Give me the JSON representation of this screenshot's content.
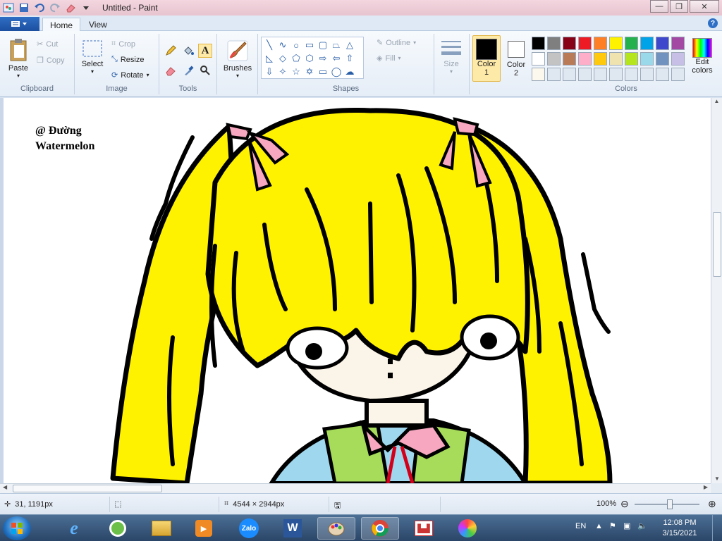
{
  "window": {
    "title": "Untitled - Paint",
    "controls": {
      "minimize": "—",
      "maximize": "❐",
      "close": "✕"
    }
  },
  "quick_access": [
    "save-icon",
    "undo-icon",
    "redo-icon",
    "eraser-icon",
    "dropdown-icon"
  ],
  "ribbon_tabs": {
    "home": "Home",
    "view": "View"
  },
  "ribbon": {
    "clipboard": {
      "label": "Clipboard",
      "paste": "Paste",
      "cut": "Cut",
      "copy": "Copy"
    },
    "image": {
      "label": "Image",
      "select": "Select",
      "crop": "Crop",
      "resize": "Resize",
      "rotate": "Rotate"
    },
    "tools": {
      "label": "Tools"
    },
    "brushes": {
      "label": "Brushes"
    },
    "shapes": {
      "label": "Shapes",
      "outline": "Outline",
      "fill": "Fill"
    },
    "size": {
      "label": "Size"
    },
    "color1": {
      "label": "Color",
      "num": "1",
      "value": "#000000"
    },
    "color2": {
      "label": "Color",
      "num": "2",
      "value": "#ffffff"
    },
    "colors": {
      "label": "Colors",
      "edit": "Edit",
      "edit2": "colors",
      "palette_row1": [
        "#000000",
        "#7f7f7f",
        "#880015",
        "#ed1c24",
        "#ff7f27",
        "#fff200",
        "#22b14c",
        "#00a2e8",
        "#3f48cc",
        "#a349a4"
      ],
      "palette_row2": [
        "#ffffff",
        "#c3c3c3",
        "#b97a57",
        "#ffaec9",
        "#ffc90e",
        "#efe4b0",
        "#b5e61d",
        "#99d9ea",
        "#7092be",
        "#c8bfe7"
      ],
      "palette_row3": [
        "#fdf8ee",
        "#dfe7f1",
        "#dfe7f1",
        "#dfe7f1",
        "#dfe7f1",
        "#dfe7f1",
        "#dfe7f1",
        "#dfe7f1",
        "#dfe7f1",
        "#dfe7f1"
      ]
    }
  },
  "canvas": {
    "signature_line1": "@ Đường",
    "signature_line2": "Watermelon"
  },
  "status": {
    "cursor_pos": "31, 1191px",
    "image_size": "4544 × 2944px",
    "zoom": "100%"
  },
  "taskbar": {
    "apps": [
      "internet-explorer-icon",
      "coccoc-icon",
      "file-explorer-icon",
      "media-player-icon",
      "zalo-icon",
      "word-icon",
      "paint-icon",
      "chrome-icon",
      "app-icon",
      "color-app-icon"
    ],
    "zalo_label": "Zalo",
    "word_label": "W",
    "lang": "EN",
    "time": "12:08 PM",
    "date": "3/15/2021"
  }
}
